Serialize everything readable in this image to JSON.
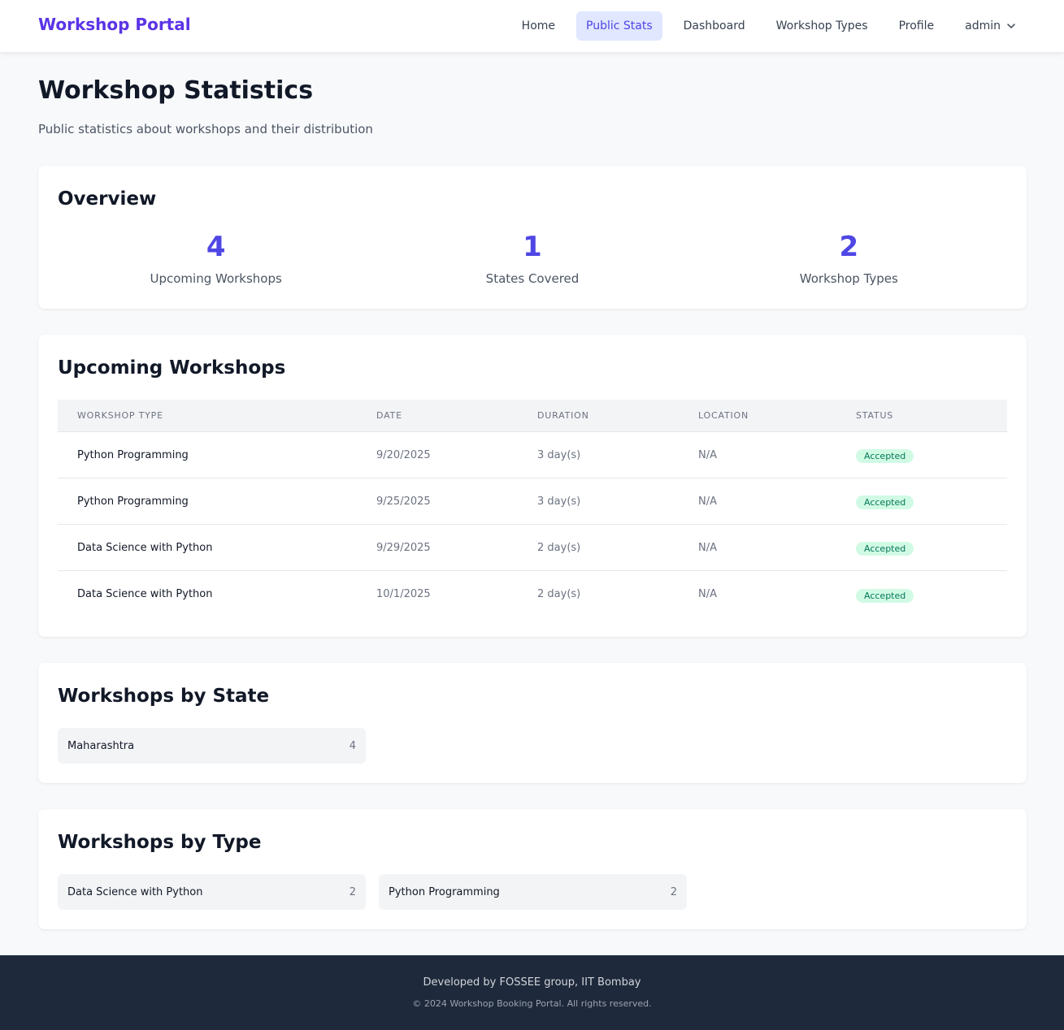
{
  "header": {
    "brand": "Workshop Portal",
    "nav": {
      "home": "Home",
      "public_stats": "Public Stats",
      "dashboard": "Dashboard",
      "workshop_types": "Workshop Types",
      "profile": "Profile",
      "user": "admin"
    },
    "active_nav": "Public Stats"
  },
  "page": {
    "title": "Workshop Statistics",
    "subtitle": "Public statistics about workshops and their distribution"
  },
  "overview": {
    "title": "Overview",
    "stats": [
      {
        "value": "4",
        "label": "Upcoming Workshops"
      },
      {
        "value": "1",
        "label": "States Covered"
      },
      {
        "value": "2",
        "label": "Workshop Types"
      }
    ]
  },
  "upcoming": {
    "title": "Upcoming Workshops",
    "columns": [
      "Workshop Type",
      "Date",
      "Duration",
      "Location",
      "Status"
    ],
    "rows": [
      {
        "type": "Python Programming",
        "date": "9/20/2025",
        "duration": "3 day(s)",
        "location": "N/A",
        "status": "Accepted"
      },
      {
        "type": "Python Programming",
        "date": "9/25/2025",
        "duration": "3 day(s)",
        "location": "N/A",
        "status": "Accepted"
      },
      {
        "type": "Data Science with Python",
        "date": "9/29/2025",
        "duration": "2 day(s)",
        "location": "N/A",
        "status": "Accepted"
      },
      {
        "type": "Data Science with Python",
        "date": "10/1/2025",
        "duration": "2 day(s)",
        "location": "N/A",
        "status": "Accepted"
      }
    ]
  },
  "by_state": {
    "title": "Workshops by State",
    "items": [
      {
        "label": "Maharashtra",
        "count": "4"
      }
    ]
  },
  "by_type": {
    "title": "Workshops by Type",
    "items": [
      {
        "label": "Data Science with Python",
        "count": "2"
      },
      {
        "label": "Python Programming",
        "count": "2"
      }
    ]
  },
  "footer": {
    "line1": "Developed by FOSSEE group, IIT Bombay",
    "line2": "© 2024 Workshop Booking Portal. All rights reserved."
  },
  "colors": {
    "brand": "#5b34e6",
    "accent": "#4f46e5",
    "active_nav_bg": "#e0e7ff",
    "badge_bg": "#d1fae5",
    "badge_text": "#047857",
    "footer_bg": "#1e293b"
  },
  "icons": {
    "user_menu": "chevron-down-icon"
  }
}
